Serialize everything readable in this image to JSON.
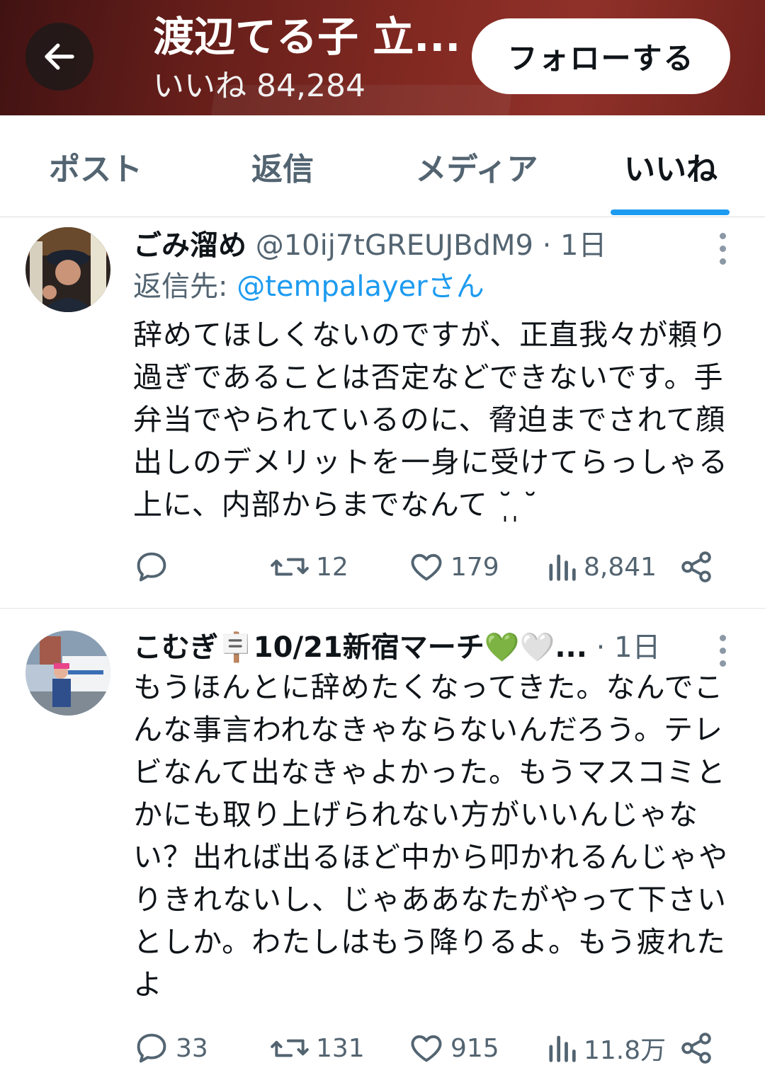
{
  "header": {
    "title": "渡辺てる子 立...",
    "subtitle": "いいね 84,284",
    "follow_label": "フォローする"
  },
  "tabs": [
    {
      "label": "ポスト"
    },
    {
      "label": "返信"
    },
    {
      "label": "メディア"
    },
    {
      "label": "いいね",
      "active": true
    }
  ],
  "posts": [
    {
      "name": "ごみ溜め",
      "meta": " @10ij7tGREUJBdM9 · 1日",
      "reply_prefix": "返信先: ",
      "reply_handle": "@tempalayerさん",
      "text": "辞めてほしくないのですが、正直我々が頼り過ぎであることは否定などできないです。手弁当でやられているのに、脅迫までされて顔出しのデメリットを一身に受けてらっしゃる上に、内部からまでなんて ˘̩ ̩˘",
      "replies": "",
      "reposts": "12",
      "likes": "179",
      "views": "8,841"
    },
    {
      "name": "こむぎ🪧10/21新宿マーチ💚🤍...",
      "meta": " · 1日",
      "text": "もうほんとに辞めたくなってきた。なんでこんな事言われなきゃならないんだろう。テレビなんて出なきゃよかった。もうマスコミとかにも取り上げられない方がいいんじゃない？出れば出るほど中から叩かれるんじゃやりきれないし、じゃああなたがやって下さいとしか。わたしはもう降りるよ。もう疲れたよ",
      "replies": "33",
      "reposts": "131",
      "likes": "915",
      "views": "11.8万"
    }
  ],
  "icons": {
    "back": "arrow-left-icon",
    "more": "more-vertical-icon",
    "reply": "reply-icon",
    "repost": "repost-icon",
    "like": "heart-icon",
    "views": "views-icon",
    "share": "share-icon"
  },
  "colors": {
    "accent": "#1d9bf0",
    "secondary_text": "#536471",
    "primary_text": "#0f1419"
  }
}
